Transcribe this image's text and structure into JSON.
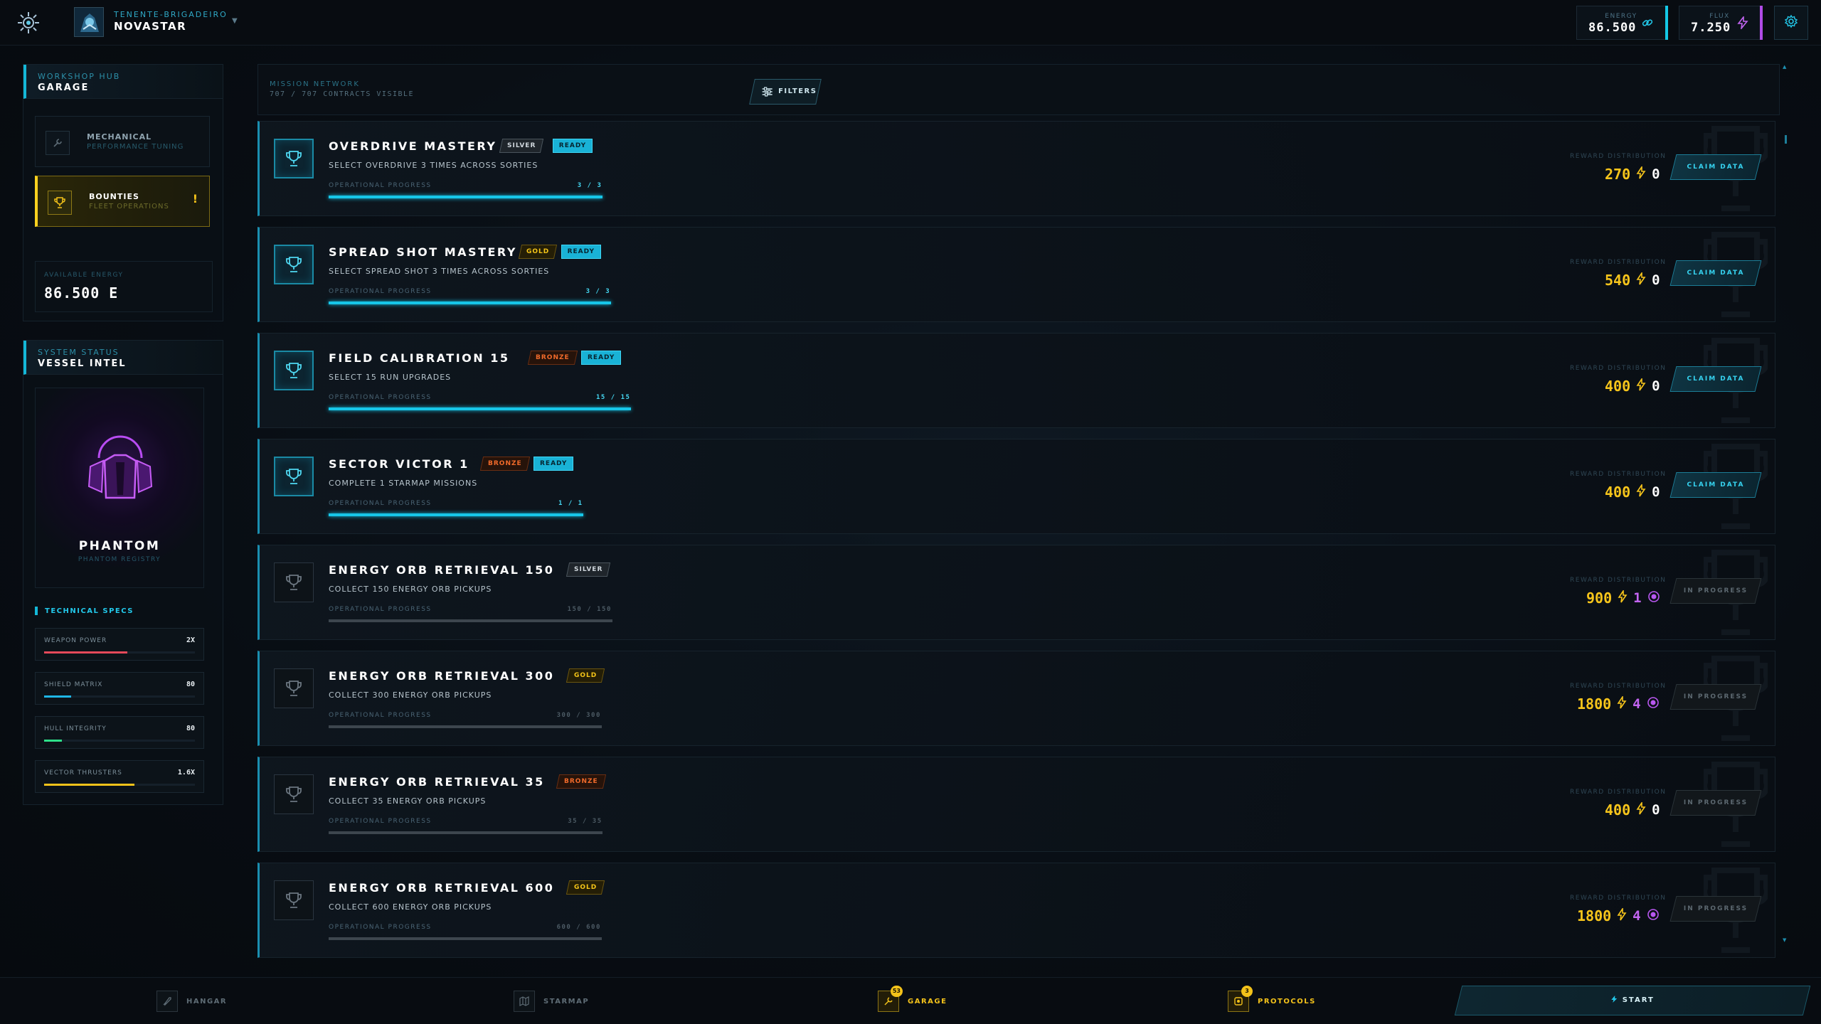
{
  "header": {
    "rank": "TENENTE-BRIGADEIRO",
    "player_name": "NOVASTAR",
    "energy": {
      "label": "ENERGY",
      "value": "86.500"
    },
    "flux": {
      "label": "FLUX",
      "value": "7.250"
    }
  },
  "sidebar": {
    "workshop": {
      "kicker": "WORKSHOP HUB",
      "title": "GARAGE"
    },
    "nav": [
      {
        "label": "MECHANICAL",
        "sub": "PERFORMANCE TUNING",
        "icon": "wrench-icon"
      },
      {
        "label": "BOUNTIES",
        "sub": "FLEET OPERATIONS",
        "icon": "trophy-icon",
        "alert": "!"
      }
    ],
    "available_energy": {
      "label": "AVAILABLE ENERGY",
      "value": "86.500 E"
    },
    "vessel": {
      "kicker": "SYSTEM STATUS",
      "title": "VESSEL INTEL",
      "ship_name": "PHANTOM",
      "registry": "PHANTOM REGISTRY"
    },
    "specs_title": "TECHNICAL SPECS",
    "specs": [
      {
        "name": "WEAPON POWER",
        "value": "2X",
        "fill": 0.55,
        "color": "#e64a5a"
      },
      {
        "name": "SHIELD MATRIX",
        "value": "80",
        "fill": 0.18,
        "color": "#1fb6e6"
      },
      {
        "name": "HULL INTEGRITY",
        "value": "80",
        "fill": 0.12,
        "color": "#2ee08a"
      },
      {
        "name": "VECTOR THRUSTERS",
        "value": "1.6X",
        "fill": 0.6,
        "color": "#f3c21a"
      }
    ]
  },
  "main": {
    "kicker": "MISSION NETWORK",
    "count": "707 / 707 CONTRACTS VISIBLE",
    "filters_label": "FILTERS",
    "progress_label": "OPERATIONAL PROGRESS",
    "reward_label": "REWARD DISTRIBUTION",
    "missions": [
      {
        "title": "OVERDRIVE MASTERY",
        "tier": "SILVER",
        "tier_class": "silver",
        "ready": "READY",
        "desc": "SELECT OVERDRIVE 3 TIMES ACROSS SORTIES",
        "progress": "3 / 3",
        "energy": "270",
        "flux": "0",
        "action": "CLAIM DATA",
        "state": "ready"
      },
      {
        "title": "SPREAD SHOT MASTERY",
        "tier": "GOLD",
        "tier_class": "gold",
        "ready": "READY",
        "desc": "SELECT SPREAD SHOT 3 TIMES ACROSS SORTIES",
        "progress": "3 / 3",
        "energy": "540",
        "flux": "0",
        "action": "CLAIM DATA",
        "state": "ready"
      },
      {
        "title": "FIELD CALIBRATION 15",
        "tier": "BRONZE",
        "tier_class": "bronze",
        "ready": "READY",
        "desc": "SELECT 15 RUN UPGRADES",
        "progress": "15 / 15",
        "energy": "400",
        "flux": "0",
        "action": "CLAIM DATA",
        "state": "ready"
      },
      {
        "title": "SECTOR VICTOR 1",
        "tier": "BRONZE",
        "tier_class": "bronze",
        "ready": "READY",
        "desc": "COMPLETE 1 STARMAP MISSIONS",
        "progress": "1 / 1",
        "energy": "400",
        "flux": "0",
        "action": "CLAIM DATA",
        "state": "ready"
      },
      {
        "title": "ENERGY ORB RETRIEVAL 150",
        "tier": "SILVER",
        "tier_class": "silver",
        "ready": "",
        "desc": "COLLECT 150 ENERGY ORB PICKUPS",
        "progress": "150 / 150",
        "energy": "900",
        "flux": "1",
        "action": "IN PROGRESS",
        "state": "prog"
      },
      {
        "title": "ENERGY ORB RETRIEVAL 300",
        "tier": "GOLD",
        "tier_class": "gold",
        "ready": "",
        "desc": "COLLECT 300 ENERGY ORB PICKUPS",
        "progress": "300 / 300",
        "energy": "1800",
        "flux": "4",
        "action": "IN PROGRESS",
        "state": "prog"
      },
      {
        "title": "ENERGY ORB RETRIEVAL 35",
        "tier": "BRONZE",
        "tier_class": "bronze",
        "ready": "",
        "desc": "COLLECT 35 ENERGY ORB PICKUPS",
        "progress": "35 / 35",
        "energy": "400",
        "flux": "0",
        "action": "IN PROGRESS",
        "state": "prog"
      },
      {
        "title": "ENERGY ORB RETRIEVAL 600",
        "tier": "GOLD",
        "tier_class": "gold",
        "ready": "",
        "desc": "COLLECT 600 ENERGY ORB PICKUPS",
        "progress": "600 / 600",
        "energy": "1800",
        "flux": "4",
        "action": "IN PROGRESS",
        "state": "prog"
      }
    ]
  },
  "bottom_nav": {
    "hangar": "HANGAR",
    "starmap": "STARMAP",
    "garage": "GARAGE",
    "garage_badge": "53",
    "protocols": "PROTOCOLS",
    "protocols_badge": "3",
    "start": "START"
  }
}
